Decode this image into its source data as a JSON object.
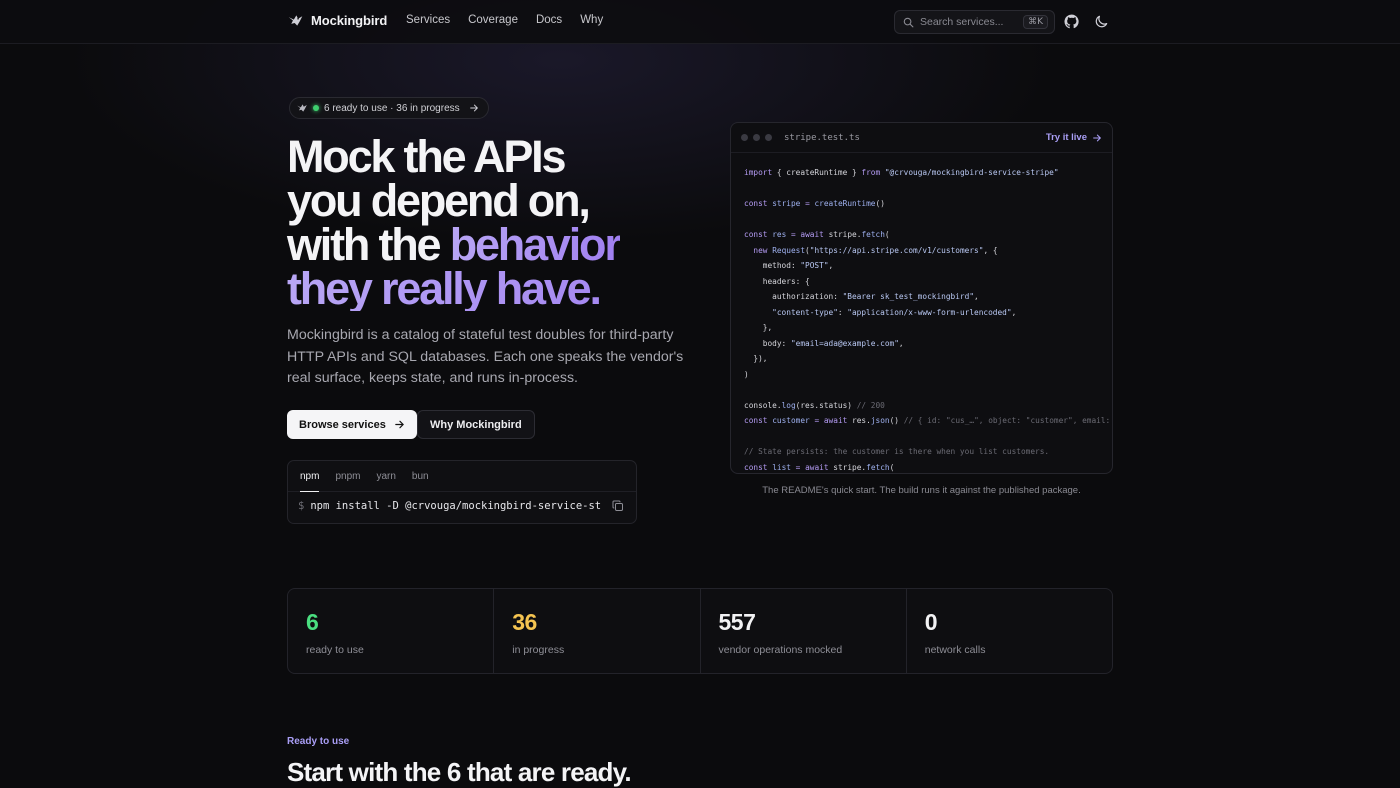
{
  "nav": {
    "brand": "Mockingbird",
    "links": [
      "Services",
      "Coverage",
      "Docs",
      "Why"
    ],
    "search_placeholder": "Search services...",
    "search_shortcut": "⌘K"
  },
  "hero": {
    "pill_text": "6 ready to use · 36 in progress",
    "headline_plain_1": "Mock the APIs",
    "headline_plain_2": "you depend on,",
    "headline_plain_3": "with the ",
    "headline_accent_3": "behavior",
    "headline_accent_4": "they really have.",
    "lede": "Mockingbird is a catalog of stateful test doubles for third-party HTTP APIs and SQL databases. Each one speaks the vendor's real surface, keeps state, and runs in-process.",
    "primary_cta": "Browse services",
    "secondary_cta": "Why Mockingbird",
    "colors": {
      "accent": "#a99ef5",
      "primary_bg": "#f5f5f7"
    }
  },
  "install": {
    "tabs": [
      "npm",
      "pnpm",
      "yarn",
      "bun"
    ],
    "active_tab": "npm",
    "prompt": "$",
    "command": "npm install -D @crvouga/mockingbird-service-stripe"
  },
  "code_window": {
    "filename": "stripe.test.ts",
    "try_label": "Try it live",
    "caption": "The README's quick start. The build runs it against the published package.",
    "lines": [
      [
        [
          "kw",
          "import"
        ],
        [
          "tx",
          " { createRuntime } "
        ],
        [
          "kw",
          "from"
        ],
        [
          "tx",
          " "
        ],
        [
          "st",
          "\"@crvouga/mockingbird-service-stripe\""
        ]
      ],
      [],
      [
        [
          "kw",
          "const"
        ],
        [
          "tx",
          " "
        ],
        [
          "vr",
          "stripe"
        ],
        [
          "tx",
          " "
        ],
        [
          "op",
          "="
        ],
        [
          "tx",
          " "
        ],
        [
          "fn",
          "createRuntime"
        ],
        [
          "tx",
          "()"
        ]
      ],
      [],
      [
        [
          "kw",
          "const"
        ],
        [
          "tx",
          " "
        ],
        [
          "vr",
          "res"
        ],
        [
          "tx",
          " "
        ],
        [
          "op",
          "="
        ],
        [
          "tx",
          " "
        ],
        [
          "kw",
          "await"
        ],
        [
          "tx",
          " stripe."
        ],
        [
          "fn",
          "fetch"
        ],
        [
          "tx",
          "("
        ]
      ],
      [
        [
          "tx",
          "  "
        ],
        [
          "kw",
          "new"
        ],
        [
          "tx",
          " "
        ],
        [
          "fn",
          "Request"
        ],
        [
          "tx",
          "("
        ],
        [
          "st",
          "\"https://api.stripe.com/v1/customers\""
        ],
        [
          "tx",
          ", {"
        ]
      ],
      [
        [
          "tx",
          "    method: "
        ],
        [
          "st",
          "\"POST\""
        ],
        [
          "tx",
          ","
        ]
      ],
      [
        [
          "tx",
          "    headers: {"
        ]
      ],
      [
        [
          "tx",
          "      authorization: "
        ],
        [
          "st",
          "\"Bearer sk_test_mockingbird\""
        ],
        [
          "tx",
          ","
        ]
      ],
      [
        [
          "tx",
          "      "
        ],
        [
          "st",
          "\"content-type\""
        ],
        [
          "tx",
          ": "
        ],
        [
          "st",
          "\"application/x-www-form-urlencoded\""
        ],
        [
          "tx",
          ","
        ]
      ],
      [
        [
          "tx",
          "    },"
        ]
      ],
      [
        [
          "tx",
          "    body: "
        ],
        [
          "st",
          "\"email=ada@example.com\""
        ],
        [
          "tx",
          ","
        ]
      ],
      [
        [
          "tx",
          "  }),"
        ]
      ],
      [
        [
          "tx",
          ")"
        ]
      ],
      [],
      [
        [
          "tx",
          "console."
        ],
        [
          "fn",
          "log"
        ],
        [
          "tx",
          "(res.status) "
        ],
        [
          "cm",
          "// 200"
        ]
      ],
      [
        [
          "kw",
          "const"
        ],
        [
          "tx",
          " "
        ],
        [
          "vr",
          "customer"
        ],
        [
          "tx",
          " "
        ],
        [
          "op",
          "="
        ],
        [
          "tx",
          " "
        ],
        [
          "kw",
          "await"
        ],
        [
          "tx",
          " res."
        ],
        [
          "fn",
          "json"
        ],
        [
          "tx",
          "() "
        ],
        [
          "cm",
          "// { id: \"cus_…\", object: \"customer\", email: \"ada@example.com\" }"
        ]
      ],
      [],
      [
        [
          "cm",
          "// State persists: the customer is there when you list customers."
        ]
      ],
      [
        [
          "kw",
          "const"
        ],
        [
          "tx",
          " "
        ],
        [
          "vr",
          "list"
        ],
        [
          "tx",
          " "
        ],
        [
          "op",
          "="
        ],
        [
          "tx",
          " "
        ],
        [
          "kw",
          "await"
        ],
        [
          "tx",
          " stripe."
        ],
        [
          "fn",
          "fetch"
        ],
        [
          "tx",
          "("
        ]
      ]
    ],
    "syntax_colors": {
      "kw": "#b59cf5",
      "st": "#b9c8f3",
      "fn": "#9fb1f0",
      "vr": "#9fb1f0",
      "op": "#b59cf5",
      "cm": "#6b6b74",
      "tx": "#d6d6dc"
    }
  },
  "stats": [
    {
      "value": "6",
      "label": "ready to use",
      "color": "#4ade80"
    },
    {
      "value": "36",
      "label": "in progress",
      "color": "#f5c451"
    },
    {
      "value": "557",
      "label": "vendor operations mocked",
      "color": "#f2f2f4"
    },
    {
      "value": "0",
      "label": "network calls",
      "color": "#f2f2f4"
    }
  ],
  "section": {
    "eyebrow": "Ready to use",
    "title": "Start with the 6 that are ready."
  }
}
